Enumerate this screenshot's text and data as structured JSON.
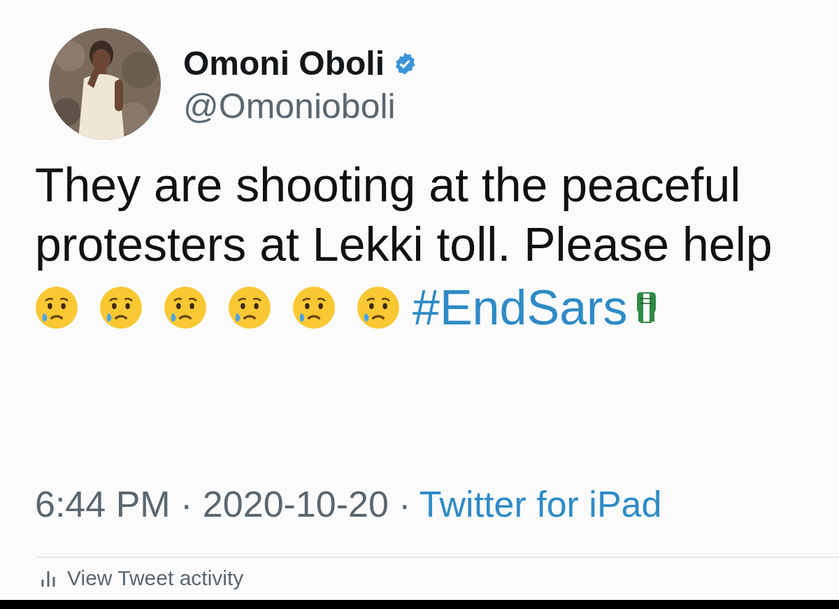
{
  "author": {
    "name": "Omoni Oboli",
    "verified": true,
    "handle": "@Omonioboli"
  },
  "tweet": {
    "text": "They are shooting at the peaceful protesters at Lekki toll. Please help",
    "inline": [
      {
        "kind": "crying-face"
      },
      {
        "kind": "crying-face"
      },
      {
        "kind": "crying-face"
      },
      {
        "kind": "crying-face"
      },
      {
        "kind": "crying-face"
      },
      {
        "kind": "crying-face"
      },
      {
        "kind": "hashtag",
        "text": "#EndSars"
      },
      {
        "kind": "flag-fist"
      }
    ]
  },
  "meta": {
    "timestamp": "6:44 PM · 2020-10-20 ·",
    "source": "Twitter for iPad"
  },
  "activity": {
    "label": "View Tweet activity"
  }
}
